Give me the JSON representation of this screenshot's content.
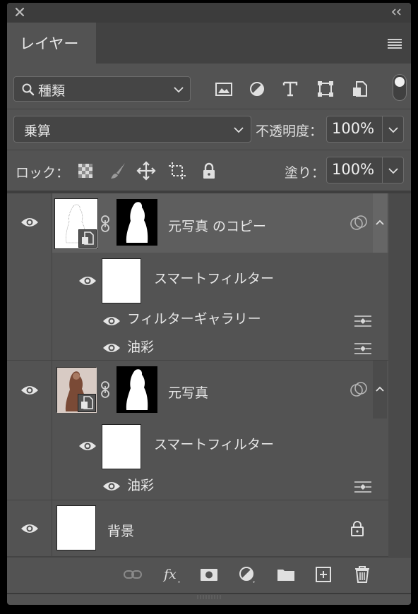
{
  "panel": {
    "tab_label": "レイヤー",
    "search": {
      "label": "種類"
    },
    "blend_mode": "乗算",
    "opacity_label": "不透明度：",
    "opacity_value": "100%",
    "lock_label": "ロック：",
    "fill_label": "塗り：",
    "fill_value": "100%"
  },
  "filter_icons": [
    "image-filter-icon",
    "adjustment-filter-icon",
    "type-filter-icon",
    "shape-filter-icon",
    "smart-object-filter-icon"
  ],
  "layers": [
    {
      "name": "元写真 のコピー",
      "selected": true,
      "smart_filters_label": "スマートフィルター",
      "filters": [
        "フィルターギャラリー",
        "油彩"
      ]
    },
    {
      "name": "元写真",
      "selected": false,
      "smart_filters_label": "スマートフィルター",
      "filters": [
        "油彩"
      ]
    },
    {
      "name": "背景",
      "locked": true
    }
  ],
  "bottom_icons": [
    "link-layers-icon",
    "fx-icon",
    "add-mask-icon",
    "adjustment-layer-icon",
    "new-group-icon",
    "new-layer-icon",
    "delete-icon"
  ],
  "colors": {
    "panel": "#535353",
    "selected_row": "#5e5e5e",
    "dark_bar": "#3c3c3c"
  }
}
